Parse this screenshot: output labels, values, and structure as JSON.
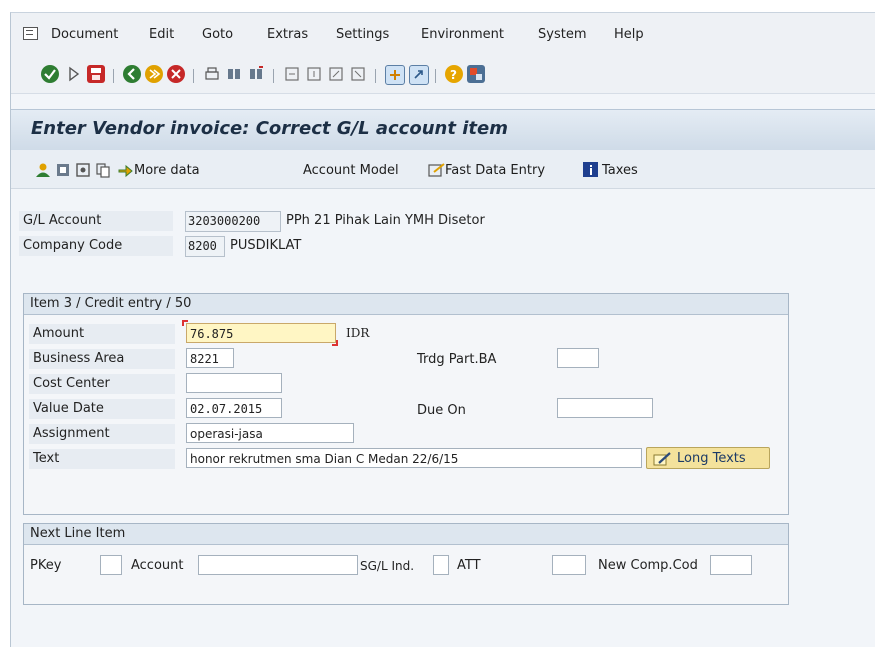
{
  "menu": {
    "items": [
      "Document",
      "Edit",
      "Goto",
      "Extras",
      "Settings",
      "Environment",
      "System",
      "Help"
    ]
  },
  "title": "Enter Vendor invoice: Correct G/L account item",
  "app_toolbar": {
    "more_data": "More data",
    "account_model": "Account Model",
    "fast_data_entry": "Fast Data Entry",
    "taxes": "Taxes"
  },
  "header": {
    "gl_account_label": "G/L Account",
    "gl_account_value": "3203000200",
    "gl_account_text": "PPh 21 Pihak Lain YMH Disetor",
    "company_code_label": "Company Code",
    "company_code_value": "8200",
    "company_code_text": "PUSDIKLAT"
  },
  "item_group": {
    "title": "Item 3 / Credit entry / 50",
    "amount_label": "Amount",
    "amount_value": "76.875",
    "currency": "IDR",
    "business_area_label": "Business Area",
    "business_area_value": "8221",
    "trdg_part_label": "Trdg Part.BA",
    "trdg_part_value": "",
    "cost_center_label": "Cost Center",
    "cost_center_value": "",
    "value_date_label": "Value Date",
    "value_date_value": "02.07.2015",
    "due_on_label": "Due On",
    "due_on_value": "",
    "assignment_label": "Assignment",
    "assignment_value": "operasi-jasa",
    "text_label": "Text",
    "text_value": "honor rekrutmen sma Dian C Medan 22/6/15",
    "long_texts": "Long Texts"
  },
  "next_line": {
    "title": "Next Line Item",
    "pkey_label": "PKey",
    "pkey_value": "",
    "account_label": "Account",
    "account_value": "",
    "sgl_label": "SG/L Ind.",
    "sgl_value": "",
    "att_label": "ATT",
    "att_value": "",
    "new_comp_label": "New Comp.Cod",
    "new_comp_value": ""
  },
  "colors": {
    "title_text": "#1c2f45",
    "focus_field": "#fff6c4",
    "button": "#f4e29c"
  }
}
